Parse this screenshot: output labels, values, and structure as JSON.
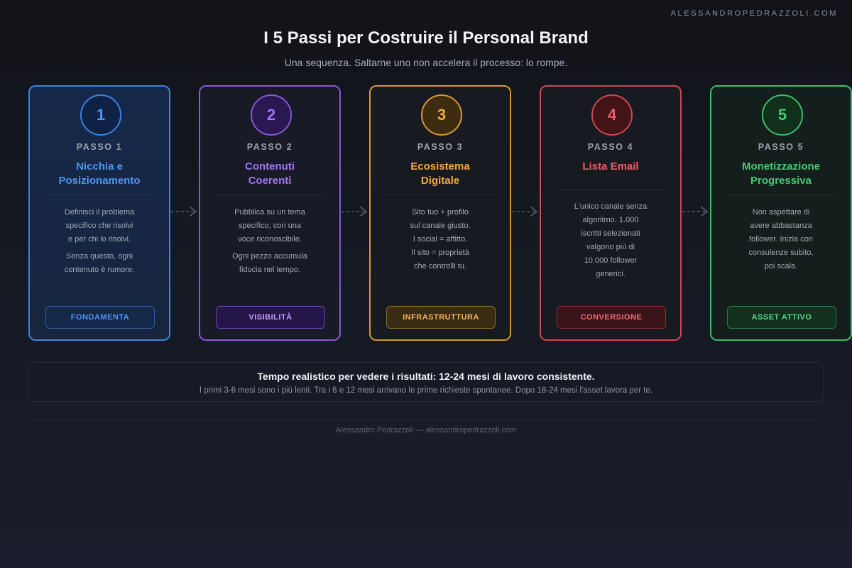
{
  "header": {
    "brand_url": "ALESSANDROPEDRAZZOLI.COM",
    "title": "I 5 Passi per Costruire il Personal Brand",
    "subtitle": "Una sequenza. Saltarne uno non accelera il processo: lo rompe."
  },
  "steps": [
    {
      "number": "1",
      "label": "PASSO 1",
      "title": "Nicchia e\nPosizionamento",
      "description": [
        "Definisci il problema\nspecifico che risolvi\ne per chi lo risolvi.",
        "Senza questo, ogni\ncontenuto è rumore."
      ],
      "badge": "FONDAMENTA",
      "color": "#3c82e0"
    },
    {
      "number": "2",
      "label": "PASSO 2",
      "title": "Contenuti\nCoerenti",
      "description": [
        "Pubblica su un tema\nspecifico, con una\nvoce riconoscibile.",
        "Ogni pezzo accumula\nfiducia nel tempo."
      ],
      "badge": "VISIBILITÀ",
      "color": "#8a55d8"
    },
    {
      "number": "3",
      "label": "PASSO 3",
      "title": "Ecosistema\nDigitale",
      "description": [
        "Sito tuo + profilo\nsul canale giusto.\nI social = affitto.\nIl sito = proprietà\nche controlli tu."
      ],
      "badge": "INFRASTRUTTURA",
      "color": "#d4982c"
    },
    {
      "number": "4",
      "label": "PASSO 4",
      "title": "Lista Email",
      "description": [
        "L'unico canale senza\nalgoritmo. 1.000\niscritti selezionati\nvalgono più di\n10.000 follower\ngenerici."
      ],
      "badge": "CONVERSIONE",
      "color": "#cf4650"
    },
    {
      "number": "5",
      "label": "PASSO 5",
      "title": "Monetizzazione\nProgressiva",
      "description": [
        "Non aspettare di\navere abbastanza\nfollower. Inizia con\nconsulenze subito,\npoi scala."
      ],
      "badge": "ASSET ATTIVO",
      "color": "#3dbd68"
    }
  ],
  "summary": {
    "title": "Tempo realistico per vedere i risultati: 12-24 mesi di lavoro consistente.",
    "detail": "I primi 3-6 mesi sono i più lenti. Tra i 6 e 12 mesi arrivano le prime richieste spontanee. Dopo 18-24 mesi l'asset lavora per te."
  },
  "footer": {
    "text": "Alessandro Pedrazzoli — alessandropedrazzoli.com"
  }
}
